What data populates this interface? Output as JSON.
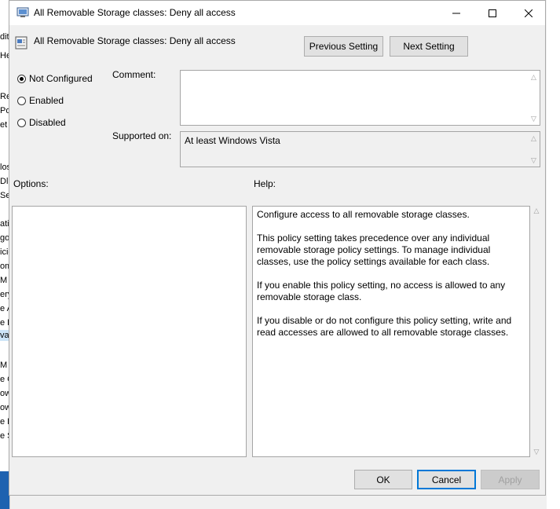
{
  "background": {
    "fragments": [
      "dit",
      "He",
      "Re",
      "Po",
      "et C",
      "los",
      "Dl",
      "Se",
      "atio",
      "gol",
      "icie",
      "om",
      "M",
      "ery",
      "e A",
      "e P",
      "val",
      "M",
      "e C",
      "ow",
      "ow",
      "e H",
      "e S"
    ]
  },
  "window": {
    "title": "All Removable Storage classes: Deny all access",
    "minimize_icon": "minimize-icon",
    "maximize_icon": "maximize-icon",
    "close_icon": "close-icon"
  },
  "header": {
    "policy_name": "All Removable Storage classes: Deny all access",
    "previous_label": "Previous Setting",
    "next_label": "Next Setting"
  },
  "state": {
    "options": [
      {
        "label": "Not Configured",
        "checked": true
      },
      {
        "label": "Enabled",
        "checked": false
      },
      {
        "label": "Disabled",
        "checked": false
      }
    ]
  },
  "comment": {
    "label": "Comment:",
    "value": ""
  },
  "supported": {
    "label": "Supported on:",
    "value": "At least Windows Vista"
  },
  "options_panel": {
    "label": "Options:"
  },
  "help_panel": {
    "label": "Help:",
    "paragraphs": [
      "Configure access to all removable storage classes.",
      "This policy setting takes precedence over any individual removable storage policy settings. To manage individual classes, use the policy settings available for each class.",
      "If you enable this policy setting, no access is allowed to any removable storage class.",
      "If you disable or do not configure this policy setting, write and read accesses are allowed to all removable storage classes."
    ]
  },
  "footer": {
    "ok_label": "OK",
    "cancel_label": "Cancel",
    "apply_label": "Apply"
  },
  "colors": {
    "focus_border": "#0078d7",
    "window_bg": "#f0f0f0",
    "taskbar": "#1e62b0"
  }
}
